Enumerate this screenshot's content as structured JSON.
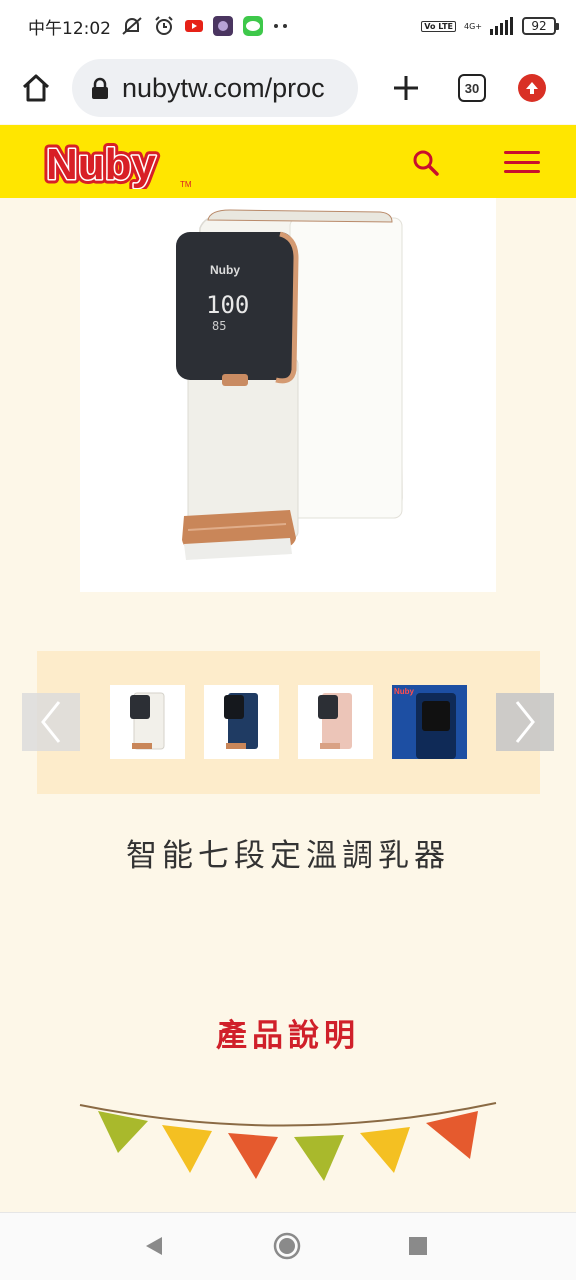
{
  "status_bar": {
    "time": "中午12:02",
    "icons": [
      "mute-notification-icon",
      "alarm-icon",
      "youtube-icon",
      "app-icon",
      "line-icon",
      "more-dots-icon"
    ],
    "volte": "Vo LTE",
    "network": "4G+",
    "signal_icon": "signal-bars-icon",
    "battery": "92"
  },
  "browser": {
    "url": "nubytw.com/proc",
    "tab_count": "30"
  },
  "site": {
    "brand_color": "#ffe600",
    "accent_color": "#c8102e",
    "logo_text": "Nuby",
    "logo_tm": "TM"
  },
  "carousel": {
    "thumbnails": [
      {
        "variant": "white",
        "color": "#f2f0ea"
      },
      {
        "variant": "navy",
        "color": "#1f3b63"
      },
      {
        "variant": "pink",
        "color": "#ecc5b8"
      },
      {
        "variant": "blue-closeup",
        "color": "#1d4fa3"
      }
    ]
  },
  "product": {
    "title": "智能七段定溫調乳器"
  },
  "section": {
    "title": "產品說明"
  }
}
